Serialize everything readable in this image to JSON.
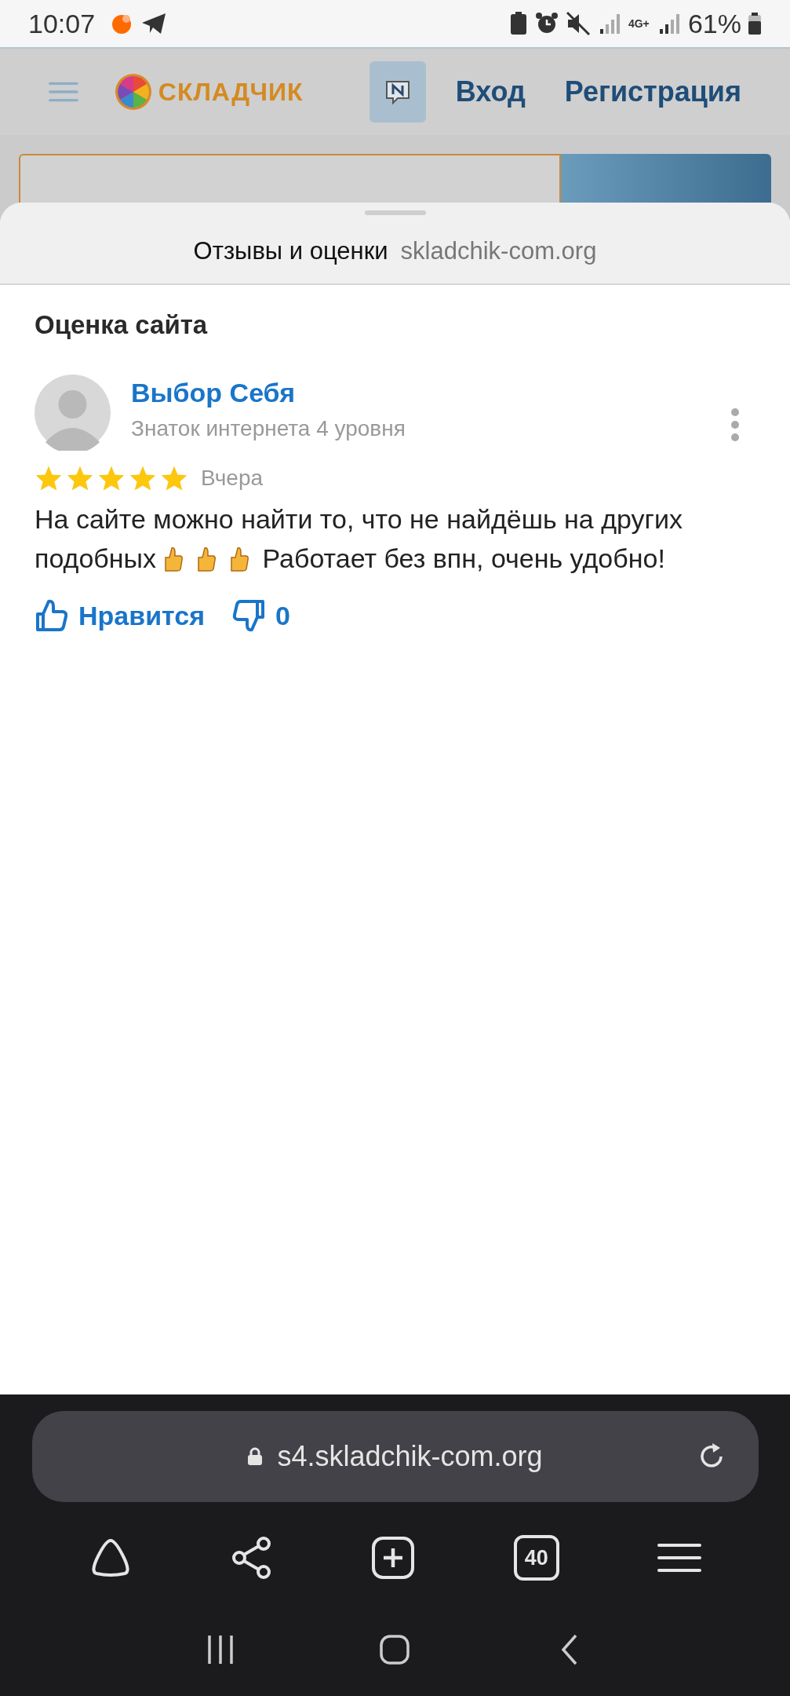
{
  "status_bar": {
    "time": "10:07",
    "battery": "61%",
    "network": "4G+"
  },
  "site_header": {
    "logo": "СКЛАДЧИК",
    "links": [
      {
        "label": "Вход"
      },
      {
        "label": "Регистрация"
      }
    ]
  },
  "sheet": {
    "title": "Отзывы и оценки",
    "domain": "skladchik-com.org"
  },
  "section_title": "Оценка сайта",
  "review": {
    "author": "Выбор Себя",
    "rank": "Знаток интернета 4 уровня",
    "stars": 5,
    "date": "Вчера",
    "text": [
      {
        "kind": "text",
        "value": "На сайте можно найти то, что не найдёшь на других подобных"
      },
      {
        "kind": "emoji"
      },
      {
        "kind": "emoji"
      },
      {
        "kind": "emoji"
      },
      {
        "kind": "text",
        "value": " Работает без впн, очень удобно!"
      }
    ],
    "like_label": "Нравится",
    "dislike_count": "0"
  },
  "address_bar": {
    "url": "s4.skladchik-com.org"
  },
  "toolbar": {
    "tabs_count": "40"
  }
}
